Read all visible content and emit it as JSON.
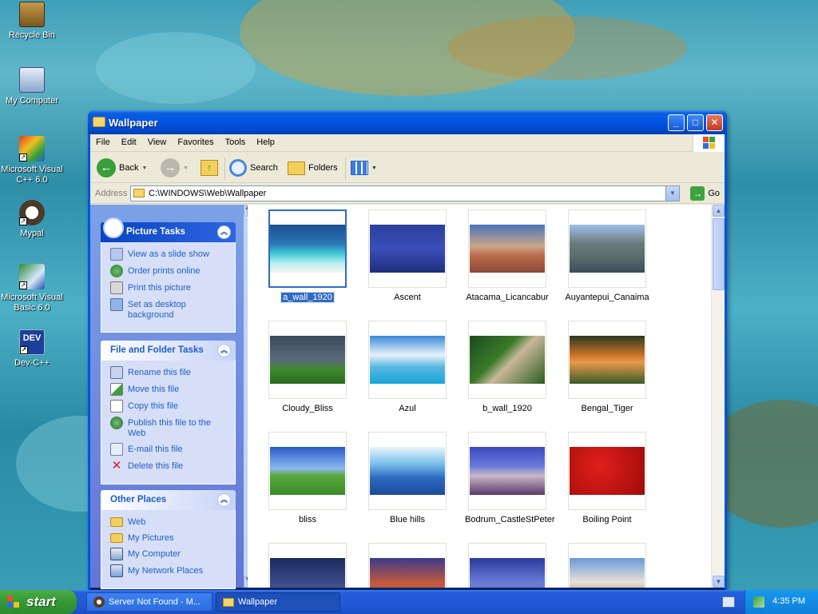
{
  "desktop": {
    "icons": [
      {
        "label": "Recycle Bin"
      },
      {
        "label": "My Computer"
      },
      {
        "label": "Microsoft Visual C++ 6.0"
      },
      {
        "label": "Mypal"
      },
      {
        "label": "Microsoft Visual Basic 6.0"
      },
      {
        "label": "Dev-C++"
      }
    ]
  },
  "window": {
    "title": "Wallpaper",
    "menu": [
      "File",
      "Edit",
      "View",
      "Favorites",
      "Tools",
      "Help"
    ],
    "toolbar": {
      "back": "Back",
      "search": "Search",
      "folders": "Folders"
    },
    "address": {
      "label": "Address",
      "value": "C:\\WINDOWS\\Web\\Wallpaper",
      "go": "Go"
    }
  },
  "taskpane": {
    "picture_tasks": {
      "title": "Picture Tasks",
      "items": [
        "View as a slide show",
        "Order prints online",
        "Print this picture",
        "Set as desktop background"
      ]
    },
    "file_tasks": {
      "title": "File and Folder Tasks",
      "items": [
        "Rename this file",
        "Move this file",
        "Copy this file",
        "Publish this file to the Web",
        "E-mail this file",
        "Delete this file"
      ]
    },
    "other_places": {
      "title": "Other Places",
      "items": [
        "Web",
        "My Pictures",
        "My Computer",
        "My Network Places"
      ]
    }
  },
  "files": [
    {
      "name": "a_wall_1920",
      "selected": true
    },
    {
      "name": "Ascent"
    },
    {
      "name": "Atacama_Licancabur"
    },
    {
      "name": "Auyantepui_Canaima"
    },
    {
      "name": "Cloudy_Bliss"
    },
    {
      "name": "Azul"
    },
    {
      "name": "b_wall_1920"
    },
    {
      "name": "Bengal_Tiger"
    },
    {
      "name": "bliss"
    },
    {
      "name": "Blue hills"
    },
    {
      "name": "Bodrum_CastleStPeter"
    },
    {
      "name": "Boiling Point"
    }
  ],
  "taskbar": {
    "start": "start",
    "tasks": [
      {
        "label": "Server Not Found - M..."
      },
      {
        "label": "Wallpaper",
        "active": true
      }
    ],
    "clock": "4:35 PM"
  }
}
